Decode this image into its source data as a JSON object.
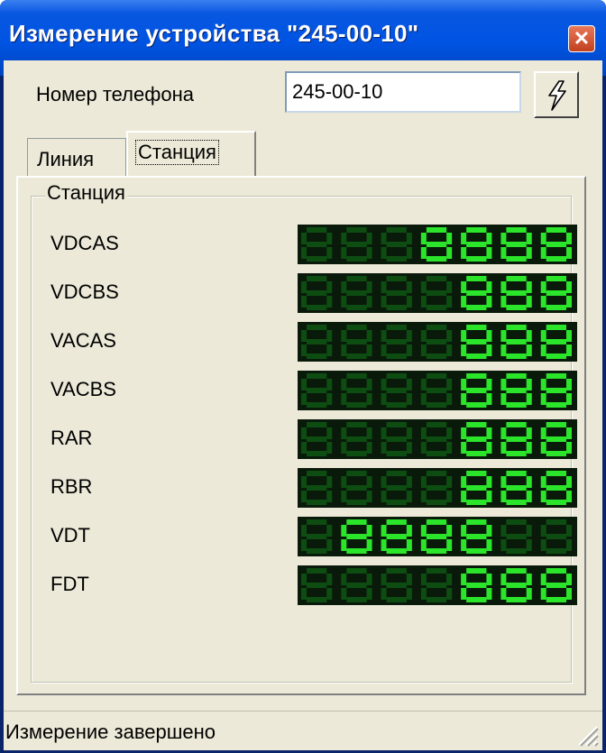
{
  "window": {
    "title": "Измерение устройства \"245-00-10\""
  },
  "form": {
    "phone_label": "Номер телефона",
    "phone_value": "245-00-10",
    "measure_button_icon": "lightning-icon"
  },
  "tabs": [
    {
      "label": "Линия",
      "active": false
    },
    {
      "label": "Станция",
      "active": true
    }
  ],
  "group": {
    "title": "Станция",
    "rows": [
      {
        "label": "VDCAS"
      },
      {
        "label": "VDCBS"
      },
      {
        "label": "VACAS"
      },
      {
        "label": "VACBS"
      },
      {
        "label": "RAR"
      },
      {
        "label": "RBR"
      },
      {
        "label": "VDT"
      },
      {
        "label": "FDT"
      }
    ]
  },
  "status": {
    "text": "Измерение завершено"
  },
  "colors": {
    "lcd_on": "#2be52b",
    "lcd_off": "#0d4d12",
    "lcd_bg": "#0a1a0a"
  }
}
